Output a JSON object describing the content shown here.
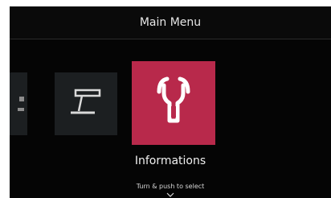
{
  "header": {
    "title": "Main Menu"
  },
  "menu": {
    "items": [
      {
        "icon": "partial-icon"
      },
      {
        "icon": "welding-torch-icon"
      },
      {
        "icon": "wrench-icon",
        "label": "Informations",
        "selected": true
      }
    ],
    "selected_label": "Informations",
    "hint": "Turn & push to select"
  },
  "colors": {
    "background": "#050505",
    "tile": "#1c1f21",
    "accent": "#b8294b",
    "text": "#f0f0f0"
  }
}
